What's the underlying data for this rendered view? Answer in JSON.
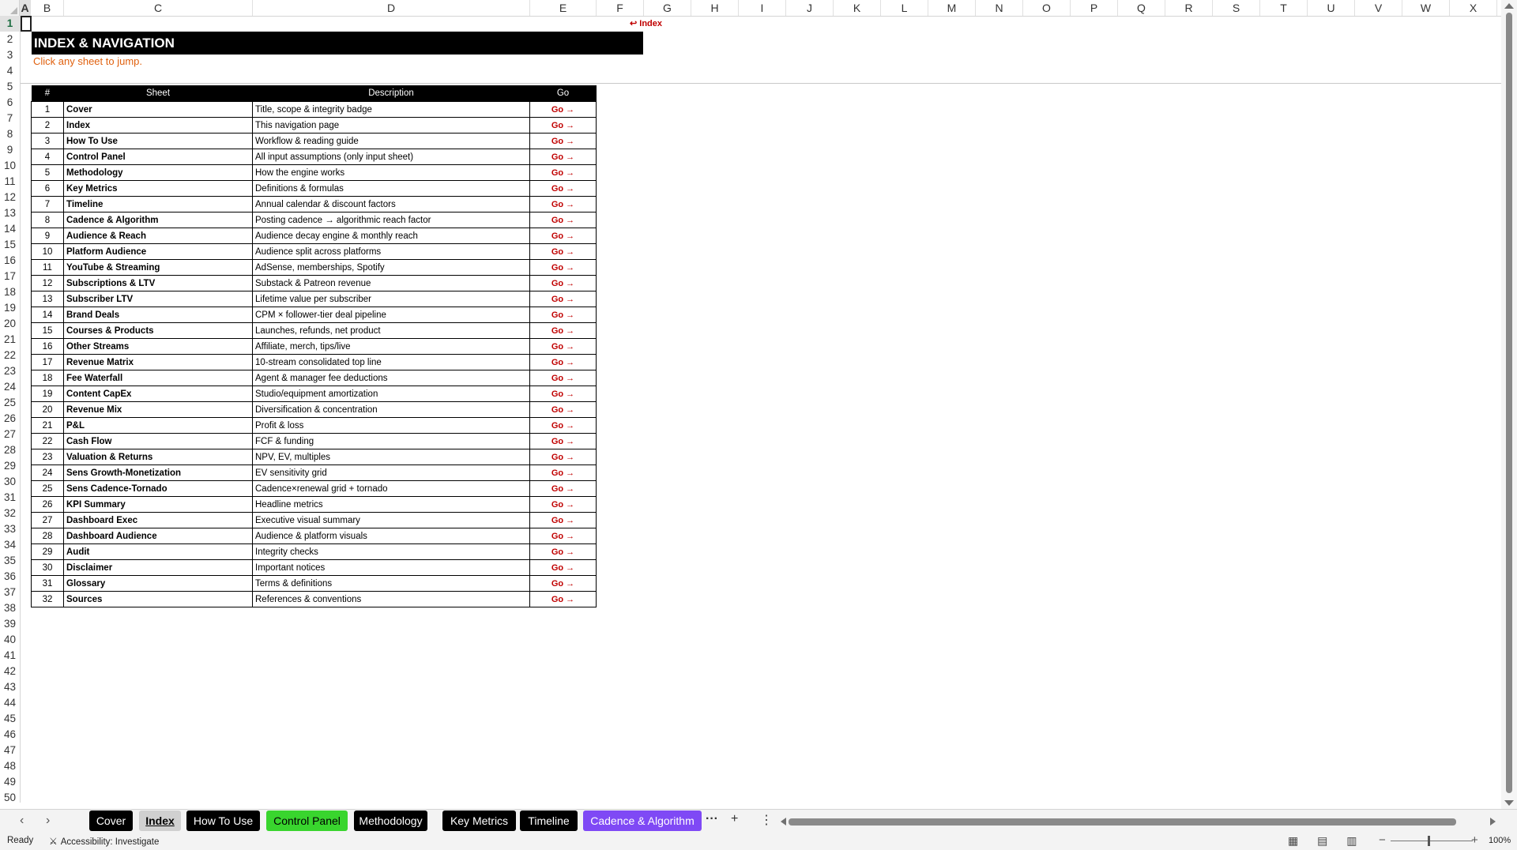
{
  "columns": [
    "A",
    "B",
    "C",
    "D",
    "E",
    "F",
    "G",
    "H",
    "I",
    "J",
    "K",
    "L",
    "M",
    "N",
    "O",
    "P",
    "Q",
    "R",
    "S",
    "T",
    "U",
    "V",
    "W",
    "X"
  ],
  "rows": [
    "1",
    "2",
    "3",
    "4",
    "5",
    "6",
    "7",
    "8",
    "9",
    "10",
    "11",
    "12",
    "13",
    "14",
    "15",
    "16",
    "17",
    "18",
    "19",
    "20",
    "21",
    "22",
    "23",
    "24",
    "25",
    "26",
    "27",
    "28",
    "29",
    "30",
    "31",
    "32",
    "33",
    "34",
    "35",
    "36",
    "37",
    "38",
    "39",
    "40",
    "41",
    "42",
    "43",
    "44",
    "45",
    "46",
    "47",
    "48",
    "49",
    "50"
  ],
  "index_link": "↩ Index",
  "title": "INDEX & NAVIGATION",
  "subtitle": "Click any sheet to jump.",
  "table": {
    "headers": [
      "#",
      "Sheet",
      "Description",
      "Go"
    ],
    "go_label": "Go →",
    "rows": [
      [
        "1",
        "Cover",
        "Title, scope & integrity badge"
      ],
      [
        "2",
        "Index",
        "This navigation page"
      ],
      [
        "3",
        "How To Use",
        "Workflow & reading guide"
      ],
      [
        "4",
        "Control Panel",
        "All input assumptions (only input sheet)"
      ],
      [
        "5",
        "Methodology",
        "How the engine works"
      ],
      [
        "6",
        "Key Metrics",
        "Definitions & formulas"
      ],
      [
        "7",
        "Timeline",
        "Annual calendar & discount factors"
      ],
      [
        "8",
        "Cadence & Algorithm",
        "Posting cadence → algorithmic reach factor"
      ],
      [
        "9",
        "Audience & Reach",
        "Audience decay engine & monthly reach"
      ],
      [
        "10",
        "Platform Audience",
        "Audience split across platforms"
      ],
      [
        "11",
        "YouTube & Streaming",
        "AdSense, memberships, Spotify"
      ],
      [
        "12",
        "Subscriptions & LTV",
        "Substack & Patreon revenue"
      ],
      [
        "13",
        "Subscriber LTV",
        "Lifetime value per subscriber"
      ],
      [
        "14",
        "Brand Deals",
        "CPM × follower-tier deal pipeline"
      ],
      [
        "15",
        "Courses & Products",
        "Launches, refunds, net product"
      ],
      [
        "16",
        "Other Streams",
        "Affiliate, merch, tips/live"
      ],
      [
        "17",
        "Revenue Matrix",
        "10-stream consolidated top line"
      ],
      [
        "18",
        "Fee Waterfall",
        "Agent & manager fee deductions"
      ],
      [
        "19",
        "Content CapEx",
        "Studio/equipment amortization"
      ],
      [
        "20",
        "Revenue Mix",
        "Diversification & concentration"
      ],
      [
        "21",
        "P&L",
        "Profit & loss"
      ],
      [
        "22",
        "Cash Flow",
        "FCF & funding"
      ],
      [
        "23",
        "Valuation & Returns",
        "NPV, EV, multiples"
      ],
      [
        "24",
        "Sens Growth-Monetization",
        "EV sensitivity grid"
      ],
      [
        "25",
        "Sens Cadence-Tornado",
        "Cadence×renewal grid + tornado"
      ],
      [
        "26",
        "KPI Summary",
        "Headline metrics"
      ],
      [
        "27",
        "Dashboard Exec",
        "Executive visual summary"
      ],
      [
        "28",
        "Dashboard Audience",
        "Audience & platform visuals"
      ],
      [
        "29",
        "Audit",
        "Integrity checks"
      ],
      [
        "30",
        "Disclaimer",
        "Important notices"
      ],
      [
        "31",
        "Glossary",
        "Terms & definitions"
      ],
      [
        "32",
        "Sources",
        "References & conventions"
      ]
    ]
  },
  "tabs": [
    {
      "label": "Cover",
      "style": "black"
    },
    {
      "label": "Index",
      "style": "active"
    },
    {
      "label": "How To Use",
      "style": "black"
    },
    {
      "label": "Control Panel",
      "style": "green"
    },
    {
      "label": "Methodology",
      "style": "black"
    },
    {
      "label": "Key Metrics",
      "style": "black"
    },
    {
      "label": "Timeline",
      "style": "black"
    },
    {
      "label": "Cadence & Algorithm",
      "style": "purple"
    }
  ],
  "tab_more": "···",
  "add_sheet": "+",
  "status": {
    "ready": "Ready",
    "accessibility": "Accessibility: Investigate",
    "zoom": "100%"
  },
  "icons": {
    "prev_sheet": "chevron-left-icon",
    "next_sheet": "chevron-right-icon",
    "accessibility": "accessibility-icon",
    "normal_view": "grid-view-icon",
    "page_layout": "page-layout-icon",
    "page_break": "page-break-icon"
  },
  "colors": {
    "banner_bg": "#000000",
    "subtitle": "#e0610f",
    "link_red": "#c00000",
    "tab_green": "#39d52e",
    "tab_purple": "#7f49f5"
  }
}
